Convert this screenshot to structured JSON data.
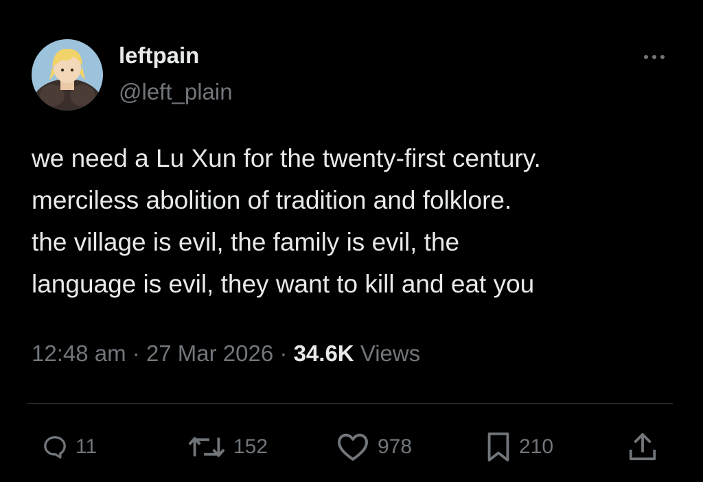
{
  "user": {
    "display_name": "leftpain",
    "handle": "@left_plain",
    "avatar_icon": "anime-avatar-icon"
  },
  "tweet": {
    "lines": [
      "we need a Lu Xun for the twenty-first century.",
      "merciless abolition of tradition and folklore.",
      "the village is evil, the family is evil, the",
      "language is evil, they want to kill and eat you"
    ]
  },
  "meta": {
    "time": "12:48 am",
    "separator": "·",
    "date": "27 Mar 2026",
    "views_count": "34.6K",
    "views_label": "Views"
  },
  "actions": {
    "replies": "11",
    "reposts": "152",
    "likes": "978",
    "bookmarks": "210"
  },
  "colors": {
    "background": "#000000",
    "text_primary": "#e7e9ea",
    "text_secondary": "#71767b",
    "divider": "#2f3336"
  }
}
